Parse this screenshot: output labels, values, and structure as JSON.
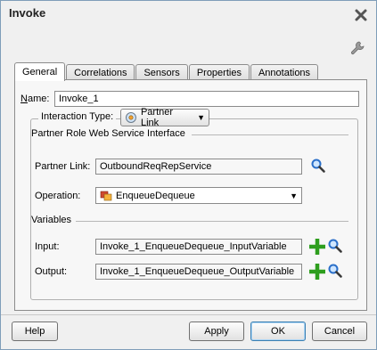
{
  "window": {
    "title": "Invoke"
  },
  "tabs": [
    {
      "label": "General"
    },
    {
      "label": "Correlations"
    },
    {
      "label": "Sensors"
    },
    {
      "label": "Properties"
    },
    {
      "label": "Annotations"
    }
  ],
  "general": {
    "name_label": "Name:",
    "name_value": "Invoke_1",
    "interaction_type_label": "Interaction Type:",
    "interaction_type_value": "Partner Link",
    "section_title": "Partner Role Web Service Interface",
    "partner_link_label": "Partner Link:",
    "partner_link_value": "OutboundReqRepService",
    "operation_label": "Operation:",
    "operation_value": "EnqueueDequeue",
    "variables_title": "Variables",
    "input_label": "Input:",
    "input_value": "Invoke_1_EnqueueDequeue_InputVariable",
    "output_label": "Output:",
    "output_value": "Invoke_1_EnqueueDequeue_OutputVariable"
  },
  "buttons": {
    "help": "Help",
    "apply": "Apply",
    "ok": "OK",
    "cancel": "Cancel"
  },
  "icons": {
    "close": "close-icon",
    "wrench": "wrench-icon",
    "search": "magnifier-icon",
    "add": "plus-icon"
  },
  "colors": {
    "add_green": "#2e9e1e",
    "search_blue": "#2a6fc9",
    "default_button_border": "#3c7fb1"
  }
}
